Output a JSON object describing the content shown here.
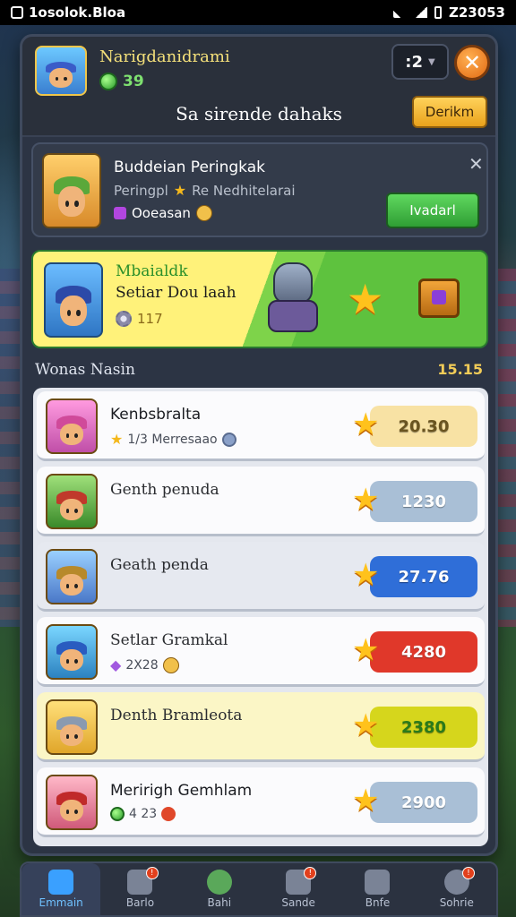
{
  "status_bar": {
    "left_text": "1osolok.Bloa",
    "right_text": "Z23053"
  },
  "header": {
    "player_name": "Narigdanidrami",
    "gem_count": "39",
    "level_value": ":2",
    "title": "Sa sirende dahaks",
    "rank_button": "Derikm"
  },
  "notification": {
    "title": "Buddeian Peringkak",
    "subtitle_left": "Peringpl",
    "subtitle_right": "Re Nedhitelarai",
    "meta_label": "Ooeasan",
    "action_button": "Ivadarl"
  },
  "banner": {
    "label": "Mbaialdk",
    "title": "Setiar Dou laah",
    "count": "117"
  },
  "section": {
    "title": "Wonas Nasin",
    "count": "15.15"
  },
  "rows": [
    {
      "name": "Kenbsbralta",
      "sub": "1/3 Merresaao",
      "score": "20.30",
      "color": "#f8e2a4",
      "text_color": "#6a5420"
    },
    {
      "name": "Genth penuda",
      "sub": "",
      "score": "1230",
      "color": "#a9bfd6",
      "text_color": "#ffffff"
    },
    {
      "name": "Geath penda",
      "sub": "",
      "score": "27.76",
      "color": "#2f6ed8",
      "text_color": "#ffffff"
    },
    {
      "name": "Setlar Gramkal",
      "sub": "2X28",
      "score": "4280",
      "color": "#e0382a",
      "text_color": "#ffffff"
    },
    {
      "name": "Denth Bramleota",
      "sub": "",
      "score": "2380",
      "color": "#d6d61c",
      "text_color": "#2a7a1a"
    },
    {
      "name": "Meririgh Gemhlam",
      "sub": "4 23",
      "score": "2900",
      "color": "#a9bfd6",
      "text_color": "#ffffff"
    }
  ],
  "nav": [
    {
      "label": "Emmain",
      "icon": "home-icon"
    },
    {
      "label": "Barlo",
      "icon": "trophy-icon"
    },
    {
      "label": "Bahi",
      "icon": "avatar-icon"
    },
    {
      "label": "Sande",
      "icon": "task-icon"
    },
    {
      "label": "Bnfe",
      "icon": "calculator-icon"
    },
    {
      "label": "Sohrie",
      "icon": "settings-icon"
    }
  ],
  "colors": {
    "accent_orange": "#e26a12",
    "accent_green": "#2f9e34",
    "star": "#ffc21c"
  }
}
